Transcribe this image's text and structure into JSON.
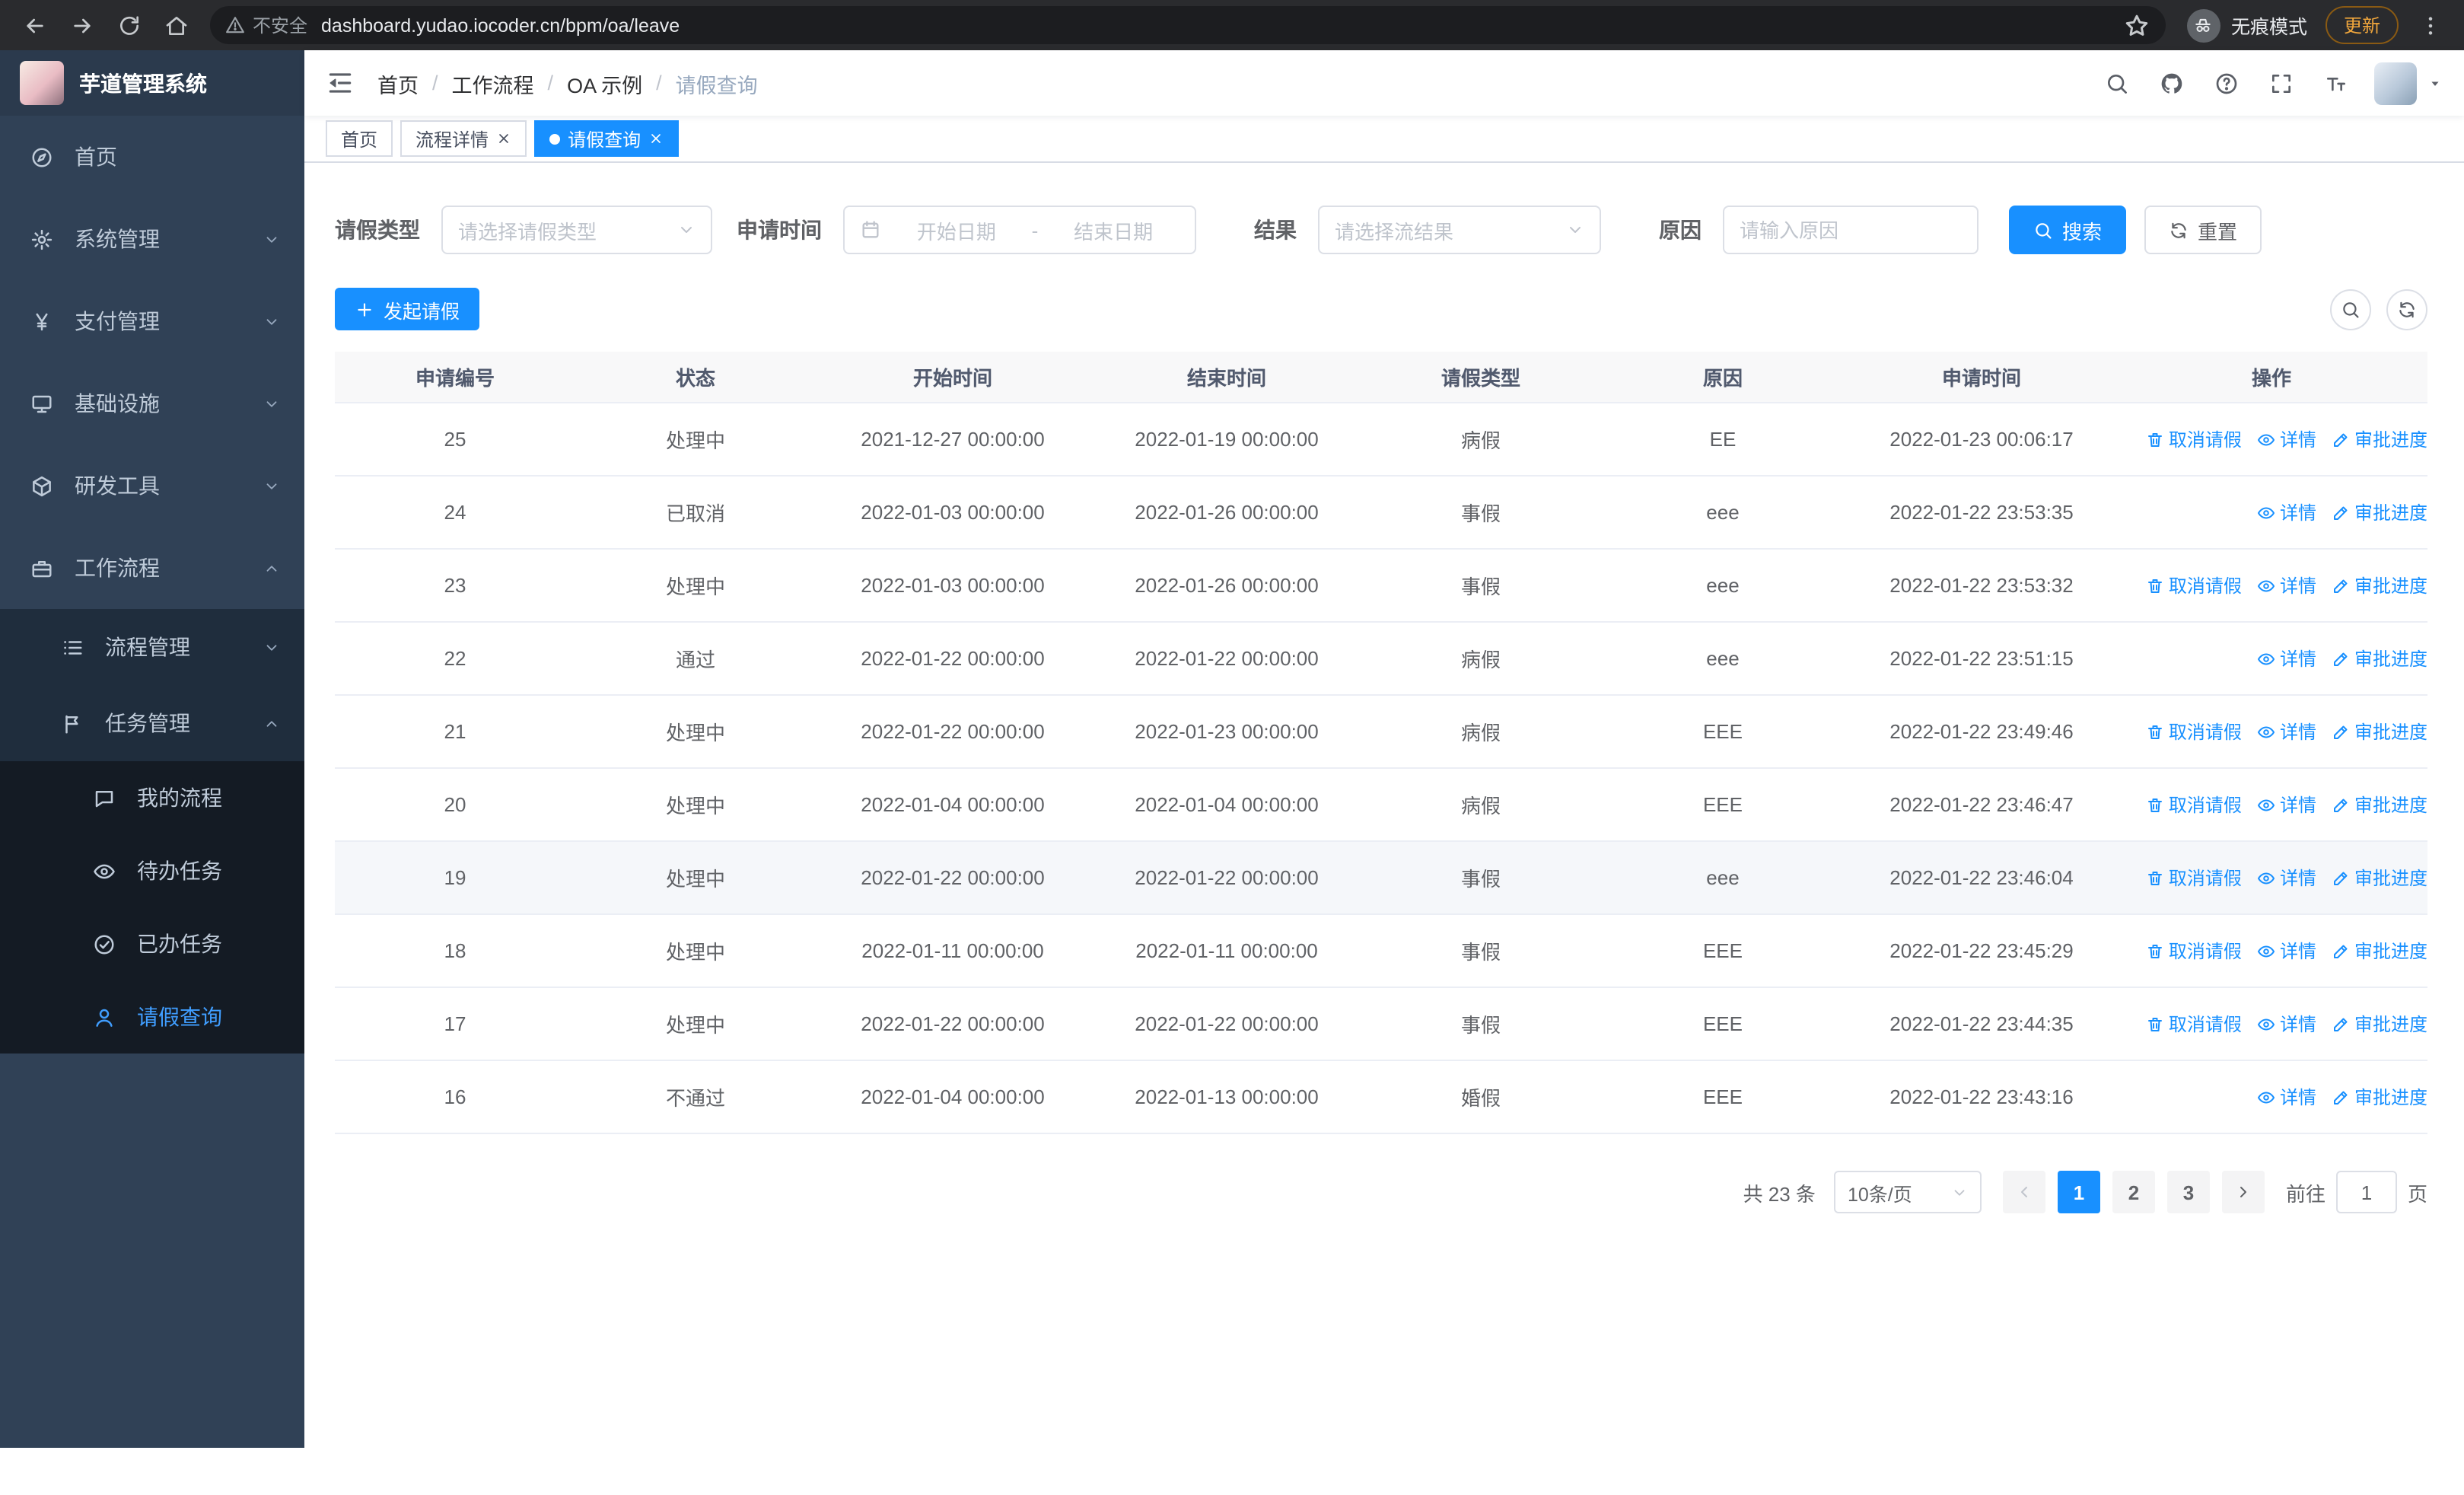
{
  "theme": {
    "primary": "#1890ff",
    "link": "#1890ff",
    "sidebar_bg": "#304156",
    "sidebar_sub_bg": "#1f2d3d",
    "sidebar_sub2_bg": "#141b24",
    "sidebar_text": "#bfcbd9",
    "active_text": "#409eff",
    "chrome_bg": "#2a2b2e",
    "update_accent": "#f0a63c"
  },
  "browser": {
    "nav_icons": [
      "back-icon",
      "forward-icon",
      "reload-icon",
      "home-icon"
    ],
    "security_label": "不安全",
    "url": "dashboard.yudao.iocoder.cn/bpm/oa/leave",
    "incognito_label": "无痕模式",
    "update_label": "更新"
  },
  "app": {
    "title": "芋道管理系统",
    "breadcrumb": [
      "首页",
      "工作流程",
      "OA 示例",
      "请假查询"
    ],
    "header_icons": [
      "search-icon",
      "github-icon",
      "question-icon",
      "fullscreen-icon",
      "font-size-icon"
    ],
    "tabs": [
      {
        "label": "首页",
        "closable": false,
        "active": false
      },
      {
        "label": "流程详情",
        "closable": true,
        "active": false
      },
      {
        "label": "请假查询",
        "closable": true,
        "active": true
      }
    ]
  },
  "sidebar": {
    "items": [
      {
        "label": "首页",
        "icon": "dashboard-icon",
        "level": 1,
        "expandable": false,
        "expanded": false,
        "active": false
      },
      {
        "label": "系统管理",
        "icon": "gear-icon",
        "level": 1,
        "expandable": true,
        "expanded": false,
        "active": false
      },
      {
        "label": "支付管理",
        "icon": "yen-icon",
        "level": 1,
        "expandable": true,
        "expanded": false,
        "active": false
      },
      {
        "label": "基础设施",
        "icon": "monitor-icon",
        "level": 1,
        "expandable": true,
        "expanded": false,
        "active": false
      },
      {
        "label": "研发工具",
        "icon": "cube-icon",
        "level": 1,
        "expandable": true,
        "expanded": false,
        "active": false
      },
      {
        "label": "工作流程",
        "icon": "briefcase-icon",
        "level": 1,
        "expandable": true,
        "expanded": true,
        "active": false
      },
      {
        "label": "流程管理",
        "icon": "list-icon",
        "level": 2,
        "expandable": true,
        "expanded": false,
        "active": false
      },
      {
        "label": "任务管理",
        "icon": "flag-icon",
        "level": 2,
        "expandable": true,
        "expanded": true,
        "active": false
      },
      {
        "label": "我的流程",
        "icon": "chat-icon",
        "level": 3,
        "expandable": false,
        "expanded": false,
        "active": false
      },
      {
        "label": "待办任务",
        "icon": "eye-icon",
        "level": 3,
        "expandable": false,
        "expanded": false,
        "active": false
      },
      {
        "label": "已办任务",
        "icon": "check-circle-icon",
        "level": 3,
        "expandable": false,
        "expanded": false,
        "active": false
      },
      {
        "label": "请假查询",
        "icon": "user-icon",
        "level": 3,
        "expandable": false,
        "expanded": false,
        "active": true
      }
    ]
  },
  "filters": {
    "leave_type": {
      "label": "请假类型",
      "placeholder": "请选择请假类型"
    },
    "apply_time": {
      "label": "申请时间",
      "start_placeholder": "开始日期",
      "separator": "-",
      "end_placeholder": "结束日期"
    },
    "result": {
      "label": "结果",
      "placeholder": "请选择流结果"
    },
    "reason": {
      "label": "原因",
      "placeholder": "请输入原因"
    },
    "search_label": "搜索",
    "reset_label": "重置"
  },
  "toolbar": {
    "create_label": "发起请假"
  },
  "table": {
    "columns": [
      "申请编号",
      "状态",
      "开始时间",
      "结束时间",
      "请假类型",
      "原因",
      "申请时间",
      "操作"
    ],
    "rows": [
      {
        "id": "25",
        "status": "处理中",
        "start_time": "2021-12-27 00:00:00",
        "end_time": "2022-01-19 00:00:00",
        "leave_type": "病假",
        "reason": "EE",
        "apply_time": "2022-01-23 00:06:17",
        "hovered": false,
        "actions": [
          {
            "icon": "delete-icon",
            "label": "取消请假"
          },
          {
            "icon": "view-icon",
            "label": "详情"
          },
          {
            "icon": "edit-icon",
            "label": "审批进度"
          }
        ]
      },
      {
        "id": "24",
        "status": "已取消",
        "start_time": "2022-01-03 00:00:00",
        "end_time": "2022-01-26 00:00:00",
        "leave_type": "事假",
        "reason": "eee",
        "apply_time": "2022-01-22 23:53:35",
        "hovered": false,
        "actions": [
          {
            "icon": "view-icon",
            "label": "详情"
          },
          {
            "icon": "edit-icon",
            "label": "审批进度"
          }
        ]
      },
      {
        "id": "23",
        "status": "处理中",
        "start_time": "2022-01-03 00:00:00",
        "end_time": "2022-01-26 00:00:00",
        "leave_type": "事假",
        "reason": "eee",
        "apply_time": "2022-01-22 23:53:32",
        "hovered": false,
        "actions": [
          {
            "icon": "delete-icon",
            "label": "取消请假"
          },
          {
            "icon": "view-icon",
            "label": "详情"
          },
          {
            "icon": "edit-icon",
            "label": "审批进度"
          }
        ]
      },
      {
        "id": "22",
        "status": "通过",
        "start_time": "2022-01-22 00:00:00",
        "end_time": "2022-01-22 00:00:00",
        "leave_type": "病假",
        "reason": "eee",
        "apply_time": "2022-01-22 23:51:15",
        "hovered": false,
        "actions": [
          {
            "icon": "view-icon",
            "label": "详情"
          },
          {
            "icon": "edit-icon",
            "label": "审批进度"
          }
        ]
      },
      {
        "id": "21",
        "status": "处理中",
        "start_time": "2022-01-22 00:00:00",
        "end_time": "2022-01-23 00:00:00",
        "leave_type": "病假",
        "reason": "EEE",
        "apply_time": "2022-01-22 23:49:46",
        "hovered": false,
        "actions": [
          {
            "icon": "delete-icon",
            "label": "取消请假"
          },
          {
            "icon": "view-icon",
            "label": "详情"
          },
          {
            "icon": "edit-icon",
            "label": "审批进度"
          }
        ]
      },
      {
        "id": "20",
        "status": "处理中",
        "start_time": "2022-01-04 00:00:00",
        "end_time": "2022-01-04 00:00:00",
        "leave_type": "病假",
        "reason": "EEE",
        "apply_time": "2022-01-22 23:46:47",
        "hovered": false,
        "actions": [
          {
            "icon": "delete-icon",
            "label": "取消请假"
          },
          {
            "icon": "view-icon",
            "label": "详情"
          },
          {
            "icon": "edit-icon",
            "label": "审批进度"
          }
        ]
      },
      {
        "id": "19",
        "status": "处理中",
        "start_time": "2022-01-22 00:00:00",
        "end_time": "2022-01-22 00:00:00",
        "leave_type": "事假",
        "reason": "eee",
        "apply_time": "2022-01-22 23:46:04",
        "hovered": true,
        "actions": [
          {
            "icon": "delete-icon",
            "label": "取消请假"
          },
          {
            "icon": "view-icon",
            "label": "详情"
          },
          {
            "icon": "edit-icon",
            "label": "审批进度"
          }
        ]
      },
      {
        "id": "18",
        "status": "处理中",
        "start_time": "2022-01-11 00:00:00",
        "end_time": "2022-01-11 00:00:00",
        "leave_type": "事假",
        "reason": "EEE",
        "apply_time": "2022-01-22 23:45:29",
        "hovered": false,
        "actions": [
          {
            "icon": "delete-icon",
            "label": "取消请假"
          },
          {
            "icon": "view-icon",
            "label": "详情"
          },
          {
            "icon": "edit-icon",
            "label": "审批进度"
          }
        ]
      },
      {
        "id": "17",
        "status": "处理中",
        "start_time": "2022-01-22 00:00:00",
        "end_time": "2022-01-22 00:00:00",
        "leave_type": "事假",
        "reason": "EEE",
        "apply_time": "2022-01-22 23:44:35",
        "hovered": false,
        "actions": [
          {
            "icon": "delete-icon",
            "label": "取消请假"
          },
          {
            "icon": "view-icon",
            "label": "详情"
          },
          {
            "icon": "edit-icon",
            "label": "审批进度"
          }
        ]
      },
      {
        "id": "16",
        "status": "不通过",
        "start_time": "2022-01-04 00:00:00",
        "end_time": "2022-01-13 00:00:00",
        "leave_type": "婚假",
        "reason": "EEE",
        "apply_time": "2022-01-22 23:43:16",
        "hovered": false,
        "actions": [
          {
            "icon": "view-icon",
            "label": "详情"
          },
          {
            "icon": "edit-icon",
            "label": "审批进度"
          }
        ]
      }
    ]
  },
  "pagination": {
    "total": "共 23 条",
    "page_size": "10条/页",
    "pages": [
      "1",
      "2",
      "3"
    ],
    "active_page": "1",
    "prev_disabled": true,
    "goto_label": "前往",
    "goto_value": "1",
    "page_unit": "页"
  }
}
